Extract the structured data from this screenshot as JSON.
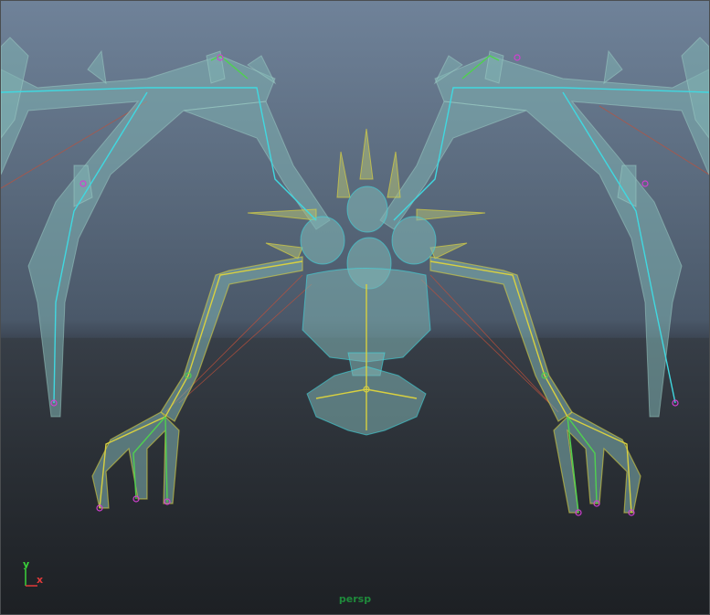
{
  "viewport": {
    "camera_name": "persp",
    "axis_y_label": "y",
    "axis_x_label": "x"
  },
  "colors": {
    "bone_fill": "#7fb3b3",
    "joint_green": "#4fd14f",
    "joint_cyan": "#40d8e0",
    "joint_magenta": "#d040d0",
    "joint_yellow": "#d8d040",
    "ik_line": "#c0503a",
    "axis_y": "#3ad13a",
    "axis_x": "#e03a3a"
  }
}
